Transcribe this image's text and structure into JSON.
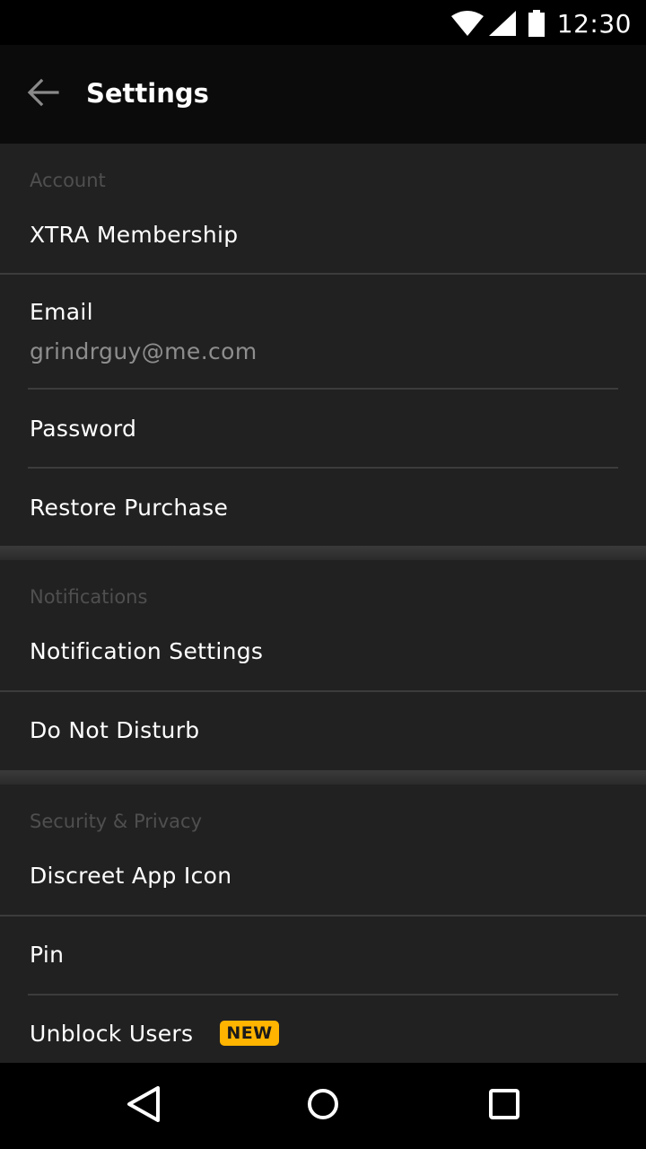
{
  "status_bar": {
    "time": "12:30",
    "icons": [
      "wifi-icon",
      "signal-icon",
      "battery-icon"
    ]
  },
  "toolbar": {
    "title": "Settings",
    "back_icon": "arrow-left-icon"
  },
  "sections": {
    "account": {
      "header": "Account",
      "items": {
        "xtra": "XTRA Membership",
        "email": "Email",
        "email_value": "grindrguy@me.com",
        "password": "Password",
        "restore": "Restore Purchase"
      }
    },
    "notifications": {
      "header": "Notifications",
      "items": {
        "settings": "Notification Settings",
        "dnd": "Do Not Disturb"
      }
    },
    "security": {
      "header": "Security & Privacy",
      "items": {
        "discreet": "Discreet App Icon",
        "pin": "Pin",
        "unblock": "Unblock Users",
        "unblock_badge": "NEW"
      }
    }
  },
  "colors": {
    "background": "#212121",
    "toolbar": "#0b0b0b",
    "badge": "#ffb400",
    "header_text": "#4f4f4f",
    "secondary_text": "#8e8e8e"
  },
  "nav_bar": {
    "icons": [
      "back-triangle-icon",
      "home-circle-icon",
      "recents-square-icon"
    ]
  }
}
